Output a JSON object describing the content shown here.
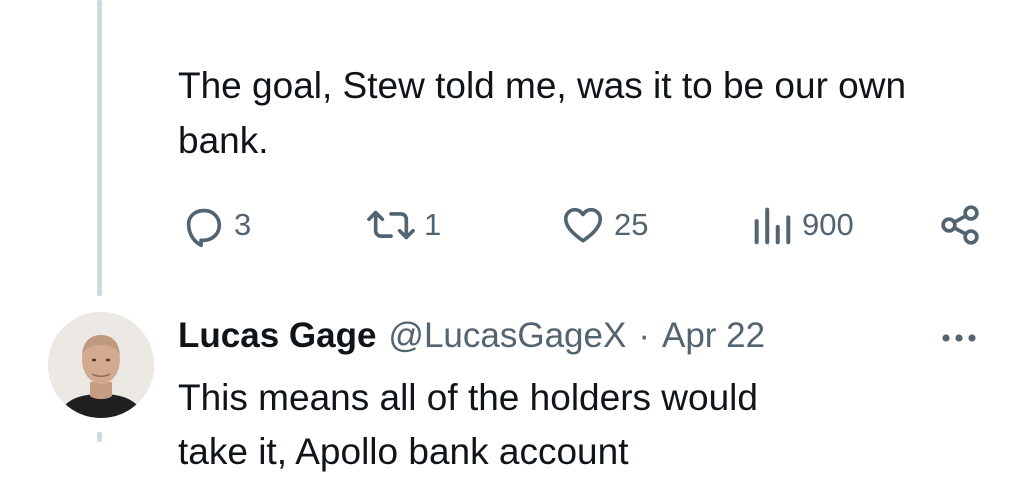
{
  "tweet": {
    "text": "The goal, Stew told me, was it to be our own\nbank.",
    "actions": {
      "reply_count": "3",
      "repost_count": "1",
      "like_count": "25",
      "view_count": "900"
    },
    "icons": [
      "reply-icon",
      "repost-icon",
      "like-icon",
      "views-icon",
      "share-icon"
    ],
    "colors": {
      "icon_gray": "#536471",
      "text": "#0f1419",
      "thread_line": "#cfd9de"
    }
  },
  "reply": {
    "display_name": "Lucas Gage",
    "handle": "@LucasGageX",
    "separator": "·",
    "date": "Apr 22",
    "text": "This means all of the holders would",
    "text_next_line_partial": "take it, Apollo bank account"
  }
}
